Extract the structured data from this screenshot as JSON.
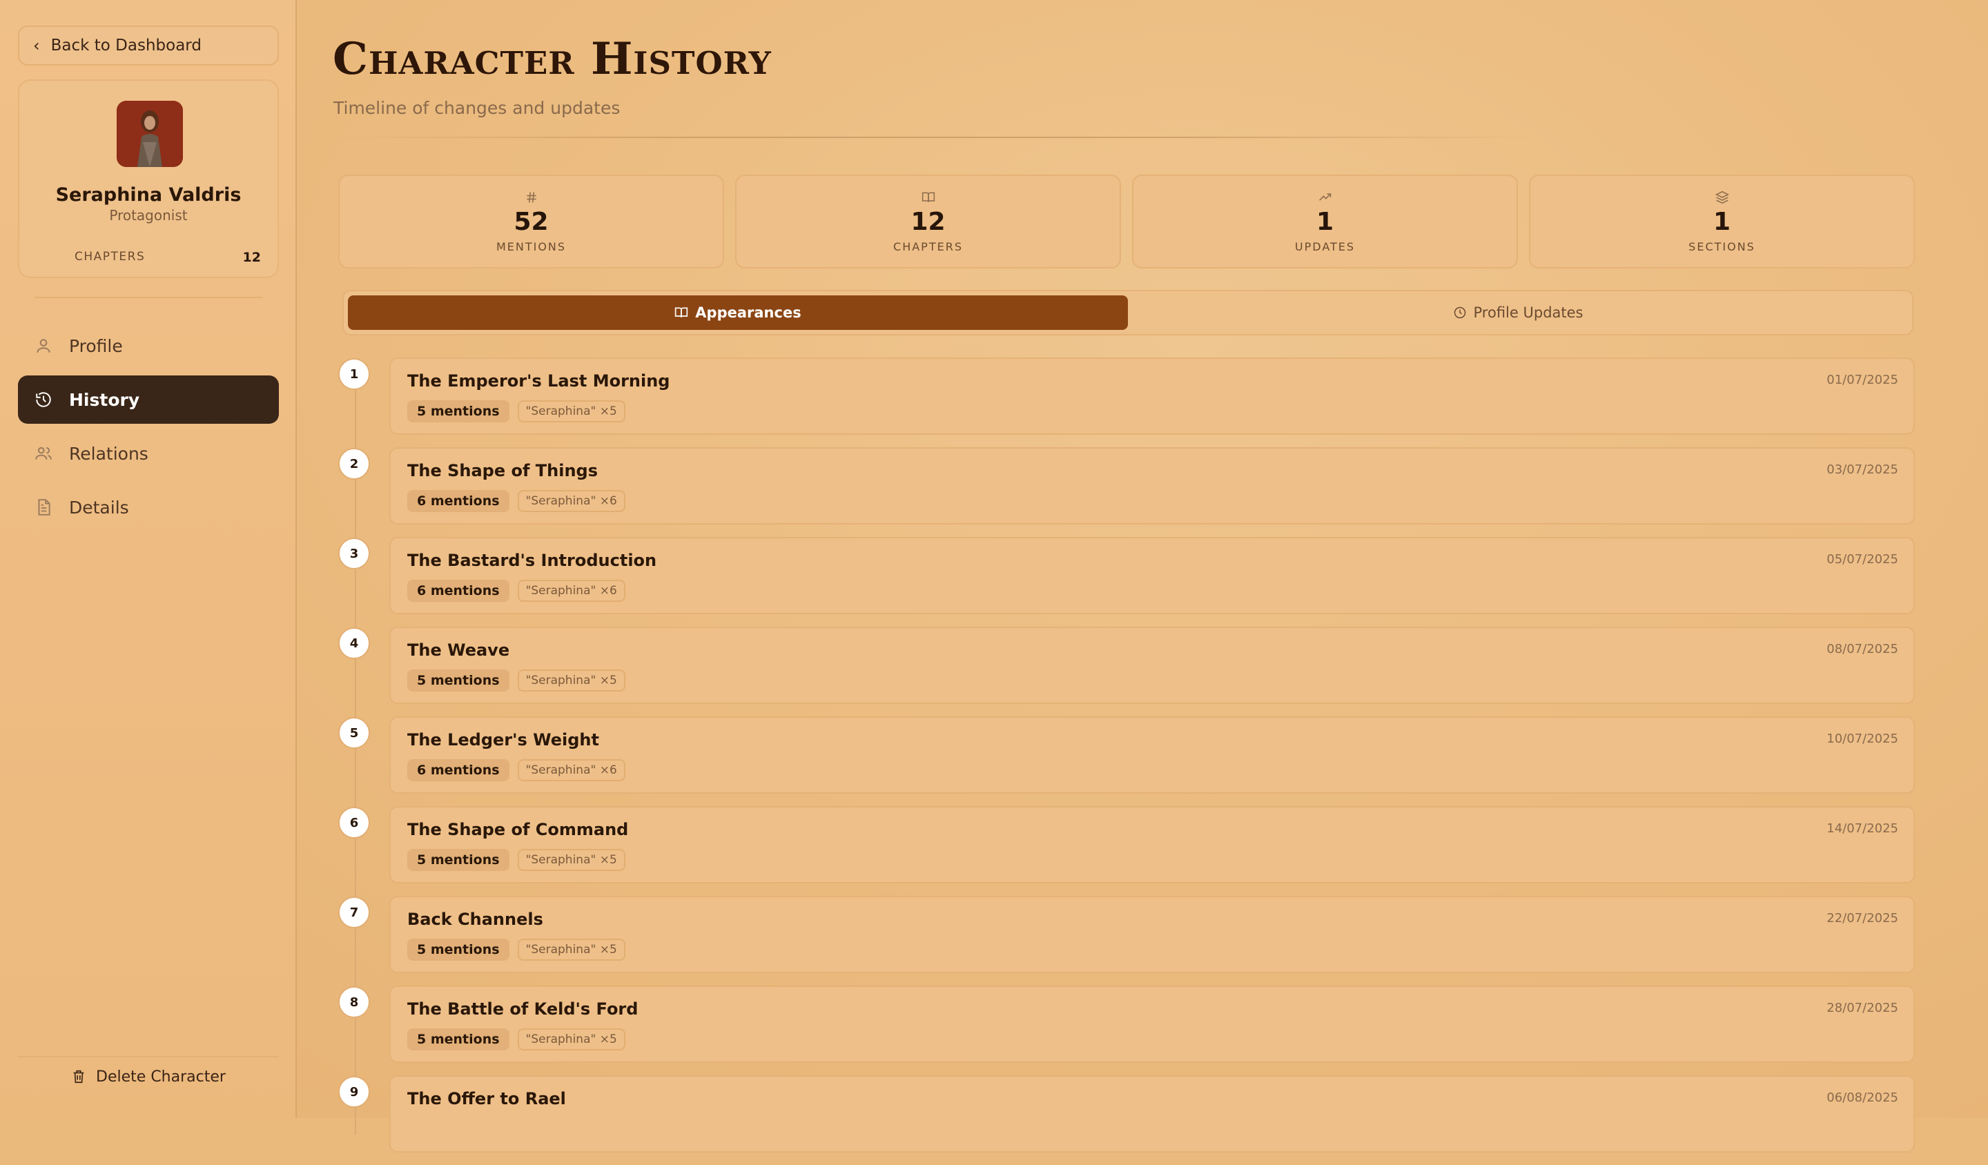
{
  "sidebar": {
    "back_label": "Back to Dashboard",
    "character": {
      "name": "Seraphina Valdris",
      "role": "Protagonist",
      "stat_label": "CHAPTERS",
      "stat_value": "12"
    },
    "nav": [
      {
        "label": "Profile",
        "icon": "user-icon"
      },
      {
        "label": "History",
        "icon": "history-icon",
        "active": true
      },
      {
        "label": "Relations",
        "icon": "users-icon"
      },
      {
        "label": "Details",
        "icon": "file-text-icon"
      }
    ],
    "delete_label": "Delete Character"
  },
  "main": {
    "title": "Character History",
    "subtitle": "Timeline of changes and updates",
    "stats": [
      {
        "value": "52",
        "label": "MENTIONS",
        "icon": "hash-icon"
      },
      {
        "value": "12",
        "label": "CHAPTERS",
        "icon": "book-icon"
      },
      {
        "value": "1",
        "label": "UPDATES",
        "icon": "trending-up-icon"
      },
      {
        "value": "1",
        "label": "SECTIONS",
        "icon": "layers-icon"
      }
    ],
    "tabs": [
      {
        "label": "Appearances",
        "icon": "book-open-icon",
        "active": true
      },
      {
        "label": "Profile Updates",
        "icon": "clock-icon"
      }
    ],
    "timeline": [
      {
        "num": "1",
        "title": "The Emperor's Last Morning",
        "mentions": "5 mentions",
        "alias": "\"Seraphina\" ×5",
        "date": "01/07/2025"
      },
      {
        "num": "2",
        "title": "The Shape of Things",
        "mentions": "6 mentions",
        "alias": "\"Seraphina\" ×6",
        "date": "03/07/2025"
      },
      {
        "num": "3",
        "title": "The Bastard's Introduction",
        "mentions": "6 mentions",
        "alias": "\"Seraphina\" ×6",
        "date": "05/07/2025"
      },
      {
        "num": "4",
        "title": "The Weave",
        "mentions": "5 mentions",
        "alias": "\"Seraphina\" ×5",
        "date": "08/07/2025"
      },
      {
        "num": "5",
        "title": "The Ledger's Weight",
        "mentions": "6 mentions",
        "alias": "\"Seraphina\" ×6",
        "date": "10/07/2025"
      },
      {
        "num": "6",
        "title": "The Shape of Command",
        "mentions": "5 mentions",
        "alias": "\"Seraphina\" ×5",
        "date": "14/07/2025"
      },
      {
        "num": "7",
        "title": "Back Channels",
        "mentions": "5 mentions",
        "alias": "\"Seraphina\" ×5",
        "date": "22/07/2025"
      },
      {
        "num": "8",
        "title": "The Battle of Keld's Ford",
        "mentions": "5 mentions",
        "alias": "\"Seraphina\" ×5",
        "date": "28/07/2025"
      },
      {
        "num": "9",
        "title": "The Offer to Rael",
        "mentions": "",
        "alias": "",
        "date": "06/08/2025"
      }
    ]
  },
  "colors": {
    "accent": "#8b4513",
    "active_nav": "#3a2618",
    "background": "#ebbb7f"
  }
}
